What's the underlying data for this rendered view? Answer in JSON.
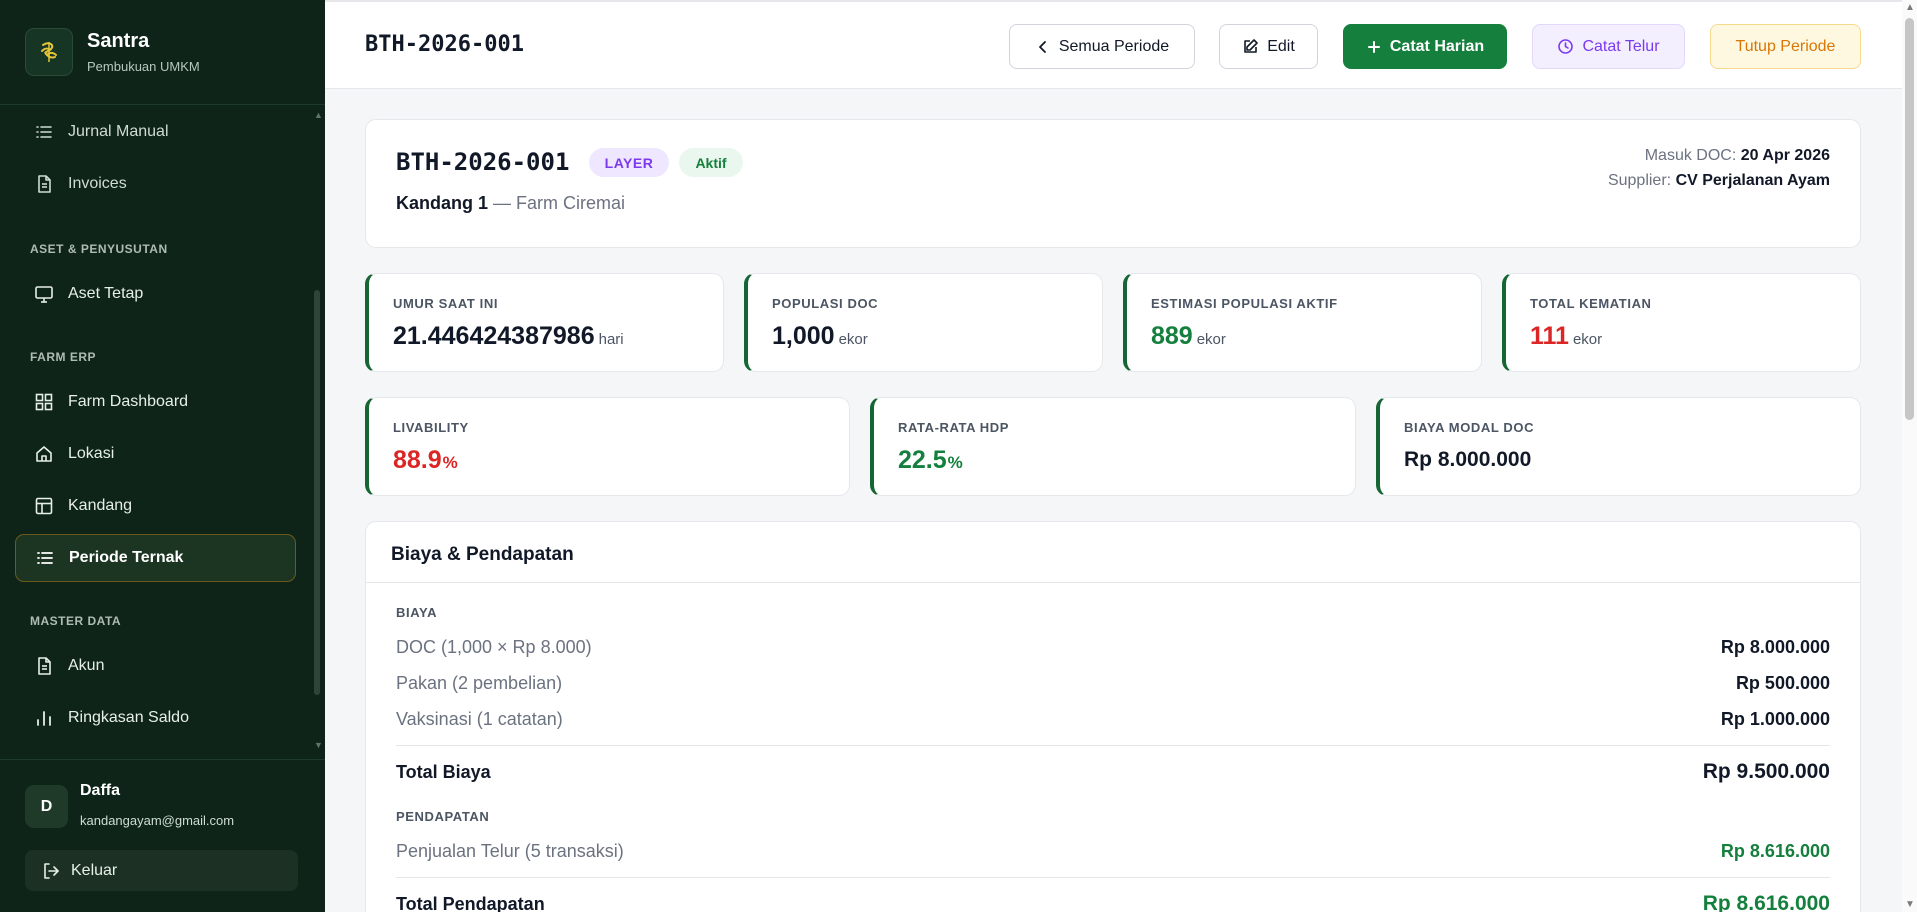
{
  "brand": {
    "name": "Santra",
    "subtitle": "Pembukuan UMKM"
  },
  "nav": {
    "items": [
      {
        "label": "Jurnal Manual"
      },
      {
        "label": "Invoices"
      },
      {
        "label": "Aset Tetap"
      },
      {
        "label": "Farm Dashboard"
      },
      {
        "label": "Lokasi"
      },
      {
        "label": "Kandang"
      },
      {
        "label": "Periode Ternak",
        "active": true
      },
      {
        "label": "Akun"
      },
      {
        "label": "Ringkasan Saldo"
      }
    ],
    "sections": [
      "ASET & PENYUSUTAN",
      "FARM ERP",
      "MASTER DATA"
    ]
  },
  "user": {
    "initial": "D",
    "name": "Daffa",
    "email": "kandangayam@gmail.com",
    "logout_label": "Keluar"
  },
  "header": {
    "title": "BTH-2026-001",
    "buttons": {
      "all_periods": "Semua Periode",
      "edit": "Edit",
      "daily": "Catat Harian",
      "eggs": "Catat Telur",
      "close": "Tutup Periode"
    }
  },
  "batch": {
    "code": "BTH-2026-001",
    "type_badge": "LAYER",
    "status_badge": "Aktif",
    "kandang": "Kandang 1",
    "farm": "— Farm Ciremai",
    "doc_date_label": "Masuk DOC:",
    "doc_date": "20 Apr 2026",
    "supplier_label": "Supplier:",
    "supplier": "CV Perjalanan Ayam"
  },
  "stats": {
    "age": {
      "label": "UMUR SAAT INI",
      "value": "21.446424387986",
      "unit": "hari"
    },
    "population_doc": {
      "label": "POPULASI DOC",
      "value": "1,000",
      "unit": "ekor"
    },
    "population_active": {
      "label": "ESTIMASI POPULASI AKTIF",
      "value": "889",
      "unit": "ekor"
    },
    "mortality": {
      "label": "TOTAL KEMATIAN",
      "value": "111",
      "unit": "ekor"
    },
    "livability": {
      "label": "LIVABILITY",
      "value": "88.9",
      "unit": "%"
    },
    "hdp": {
      "label": "RATA-RATA HDP",
      "value": "22.5",
      "unit": "%"
    },
    "doc_cost": {
      "label": "BIAYA MODAL DOC",
      "value": "Rp 8.000.000"
    }
  },
  "finance": {
    "title": "Biaya & Pendapatan",
    "costs_label": "BIAYA",
    "costs": [
      {
        "label": "DOC (1,000 × Rp 8.000)",
        "value": "Rp 8.000.000"
      },
      {
        "label": "Pakan (2 pembelian)",
        "value": "Rp 500.000"
      },
      {
        "label": "Vaksinasi (1 catatan)",
        "value": "Rp 1.000.000"
      }
    ],
    "total_cost_label": "Total Biaya",
    "total_cost": "Rp 9.500.000",
    "revenue_label": "PENDAPATAN",
    "revenue": [
      {
        "label": "Penjualan Telur (5 transaksi)",
        "value": "Rp 8.616.000"
      }
    ],
    "total_revenue_label": "Total Pendapatan",
    "total_revenue": "Rp 8.616.000"
  },
  "colors": {
    "sidebar_bg": "#0e2418",
    "accent_green": "#15803d",
    "danger_red": "#dc2626",
    "purple": "#7c3aed",
    "amber": "#d97706"
  }
}
